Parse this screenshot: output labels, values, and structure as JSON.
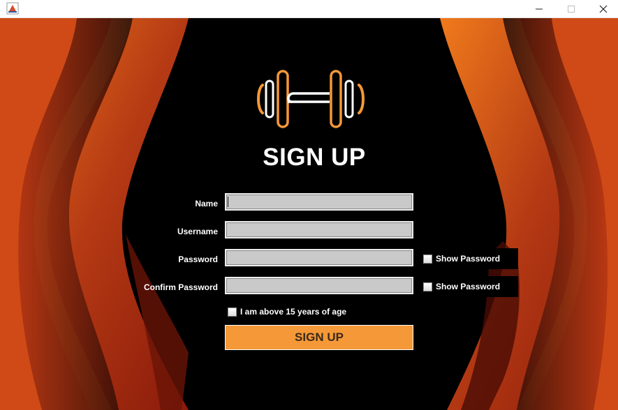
{
  "window": {
    "minimize_icon": "minimize-icon",
    "maximize_icon": "maximize-icon",
    "close_icon": "close-icon"
  },
  "header": {
    "logo_icon": "dumbbell-icon",
    "title": "SIGN UP"
  },
  "form": {
    "name_label": "Name",
    "name_value": "",
    "username_label": "Username",
    "username_value": "",
    "password_label": "Password",
    "password_value": "",
    "confirm_label": "Confirm Password",
    "confirm_value": "",
    "show_password_1": "Show Password",
    "show_password_2": "Show Password",
    "age_check_label": "I am above 15 years of age",
    "submit_label": "SIGN UP"
  },
  "colors": {
    "accent": "#f59837",
    "background": "#000000",
    "field": "#c9c9c9"
  }
}
